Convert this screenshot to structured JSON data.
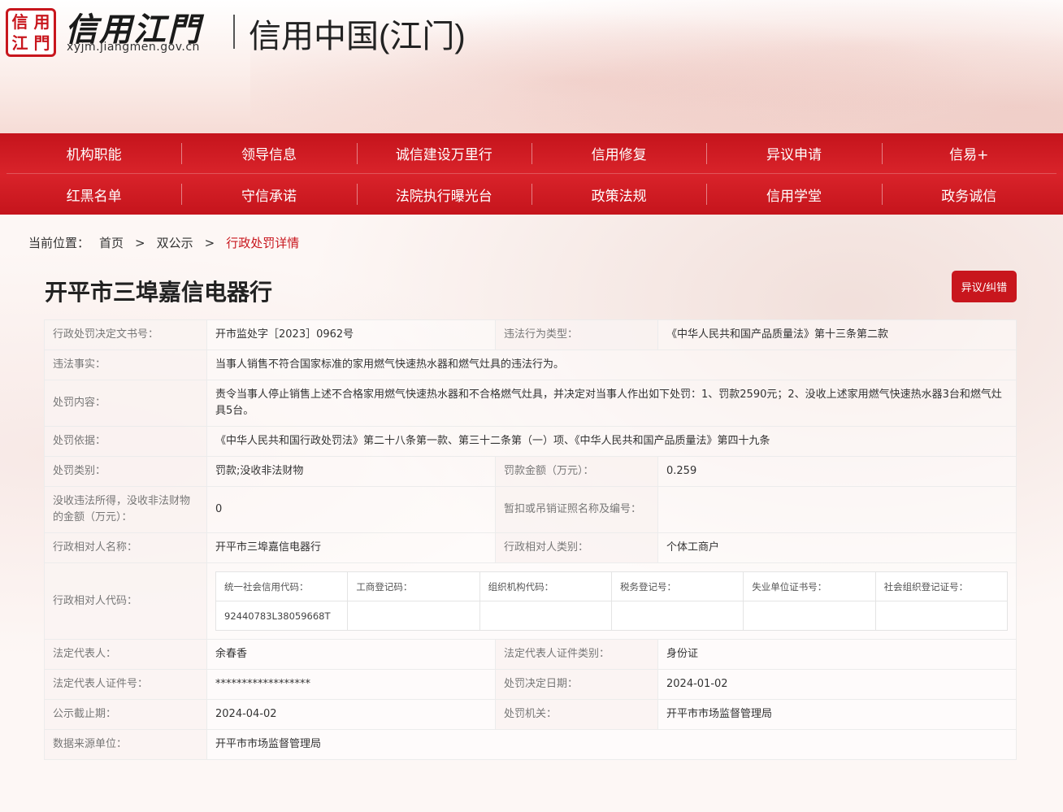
{
  "header": {
    "seal_chars": [
      "信",
      "用",
      "江",
      "門"
    ],
    "logo_title": "信用江門",
    "logo_url": "xyjm.jiangmen.gov.cn",
    "site_name": "信用中国(江门)"
  },
  "nav": {
    "row1": [
      "机构职能",
      "领导信息",
      "诚信建设万里行",
      "信用修复",
      "异议申请",
      "信易+"
    ],
    "row2": [
      "红黑名单",
      "守信承诺",
      "法院执行曝光台",
      "政策法规",
      "信用学堂",
      "政务诚信"
    ]
  },
  "breadcrumb": {
    "label": "当前位置：",
    "home": "首页",
    "section": "双公示",
    "current": "行政处罚详情",
    "sep": ">"
  },
  "title": "开平市三埠嘉信电器行",
  "objection_button": "异议/纠错",
  "detail": {
    "doc_no_label": "行政处罚决定文书号：",
    "doc_no": "开市监处字［2023］0962号",
    "violation_type_label": "违法行为类型：",
    "violation_type": "《中华人民共和国产品质量法》第十三条第二款",
    "facts_label": "违法事实：",
    "facts": "当事人销售不符合国家标准的家用燃气快速热水器和燃气灶具的违法行为。",
    "content_label": "处罚内容：",
    "content": "责令当事人停止销售上述不合格家用燃气快速热水器和不合格燃气灶具，并决定对当事人作出如下处罚：1、罚款2590元；2、没收上述家用燃气快速热水器3台和燃气灶具5台。",
    "basis_label": "处罚依据：",
    "basis": "《中华人民共和国行政处罚法》第二十八条第一款、第三十二条第（一）项、《中华人民共和国产品质量法》第四十九条",
    "category_label": "处罚类别：",
    "category": "罚款;没收非法财物",
    "amount_label": "罚款金额（万元）：",
    "amount": "0.259",
    "confiscated_label": "没收违法所得，没收非法财物的金额（万元）：",
    "confiscated": "0",
    "license_label": "暂扣或吊销证照名称及编号：",
    "license": "",
    "party_name_label": "行政相对人名称：",
    "party_name": "开平市三埠嘉信电器行",
    "party_type_label": "行政相对人类别：",
    "party_type": "个体工商户",
    "party_code_label": "行政相对人代码：",
    "codes": {
      "headers": [
        "统一社会信用代码：",
        "工商登记码：",
        "组织机构代码：",
        "税务登记号：",
        "失业单位证书号：",
        "社会组织登记证号："
      ],
      "values": [
        "92440783L38059668T",
        "",
        "",
        "",
        "",
        ""
      ]
    },
    "legal_rep_label": "法定代表人：",
    "legal_rep": "余春香",
    "legal_rep_id_type_label": "法定代表人证件类别：",
    "legal_rep_id_type": "身份证",
    "legal_rep_id_label": "法定代表人证件号：",
    "legal_rep_id": "******************",
    "decision_date_label": "处罚决定日期：",
    "decision_date": "2024-01-02",
    "expiry_label": "公示截止期：",
    "expiry": "2024-04-02",
    "authority_label": "处罚机关：",
    "authority": "开平市市场监督管理局",
    "source_label": "数据来源单位：",
    "source": "开平市市场监督管理局"
  }
}
